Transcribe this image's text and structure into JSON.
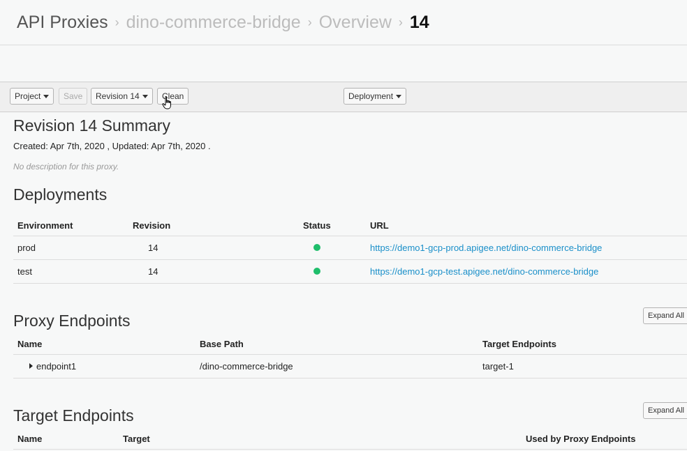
{
  "breadcrumb": {
    "root": "API Proxies",
    "proxy": "dino-commerce-bridge",
    "section": "Overview",
    "current": "14",
    "separator": "›"
  },
  "toolbar": {
    "project_label": "Project",
    "save_label": "Save",
    "revision_label": "Revision 14",
    "clean_label": "Clean",
    "deployment_label": "Deployment"
  },
  "summary": {
    "title": "Revision 14 Summary",
    "meta": "Created: Apr 7th, 2020 , Updated: Apr 7th, 2020 .",
    "description": "No description for this proxy."
  },
  "deployments": {
    "title": "Deployments",
    "headers": {
      "environment": "Environment",
      "revision": "Revision",
      "status": "Status",
      "url": "URL"
    },
    "rows": [
      {
        "environment": "prod",
        "revision": "14",
        "status_color": "#1fbe6b",
        "url": "https://demo1-gcp-prod.apigee.net/dino-commerce-bridge"
      },
      {
        "environment": "test",
        "revision": "14",
        "status_color": "#1fbe6b",
        "url": "https://demo1-gcp-test.apigee.net/dino-commerce-bridge"
      }
    ]
  },
  "proxy_endpoints": {
    "title": "Proxy Endpoints",
    "expand_label": "Expand All",
    "headers": {
      "name": "Name",
      "base_path": "Base Path",
      "target_endpoints": "Target Endpoints"
    },
    "rows": [
      {
        "name": "endpoint1",
        "base_path": "/dino-commerce-bridge",
        "target_endpoints": "target-1"
      }
    ]
  },
  "target_endpoints": {
    "title": "Target Endpoints",
    "expand_label": "Expand All",
    "headers": {
      "name": "Name",
      "target": "Target",
      "used_by": "Used by Proxy Endpoints"
    }
  },
  "icons": {
    "caret": "caret-down-icon",
    "expand": "triangle-right-icon",
    "cursor": "hand-pointer-icon",
    "status": "status-dot-icon"
  },
  "colors": {
    "link": "#1a8fc9",
    "status_ok": "#1fbe6b"
  }
}
